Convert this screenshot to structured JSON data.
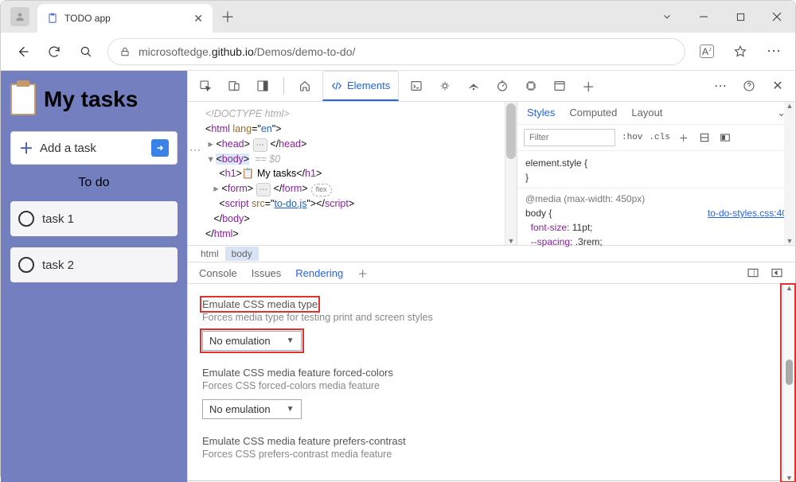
{
  "window": {
    "tab_title": "TODO app",
    "url_prefix": "microsoftedge.",
    "url_domain": "github.io",
    "url_path": "/Demos/demo-to-do/"
  },
  "page": {
    "title": "My tasks",
    "add_task": "Add a task",
    "section": "To do",
    "tasks": [
      "task 1",
      "task 2"
    ]
  },
  "devtools": {
    "elements_tab": "Elements",
    "dom": {
      "doctype": "<!DOCTYPE html>",
      "html_open": "html",
      "html_lang": "en",
      "head": "head",
      "body": "body",
      "body_sel": "== $0",
      "h1_open": "h1",
      "h1_text": " My tasks",
      "form": "form",
      "flex": "flex",
      "script": "script",
      "script_src": "to-do.js"
    },
    "crumbs": {
      "html": "html",
      "body": "body"
    },
    "styles": {
      "tabs": {
        "styles": "Styles",
        "computed": "Computed",
        "layout": "Layout"
      },
      "filter_ph": "Filter",
      "hov": ":hov",
      "cls": ".cls",
      "el_style": "element.style {",
      "brace": "}",
      "media": "@media (max-width: 450px)",
      "link": "to-do-styles.css:40",
      "body_sel": "body {",
      "p1": "font-size",
      "v1": "11pt",
      "p2": "--spacing",
      "v2": ".3rem"
    },
    "drawer": {
      "tabs": {
        "console": "Console",
        "issues": "Issues",
        "rendering": "Rendering"
      },
      "s1_title": "Emulate CSS media type",
      "s1_desc": "Forces media type for testing print and screen styles",
      "s1_value": "No emulation",
      "s2_title": "Emulate CSS media feature forced-colors",
      "s2_desc": "Forces CSS forced-colors media feature",
      "s2_value": "No emulation",
      "s3_title": "Emulate CSS media feature prefers-contrast",
      "s3_desc": "Forces CSS prefers-contrast media feature"
    }
  }
}
